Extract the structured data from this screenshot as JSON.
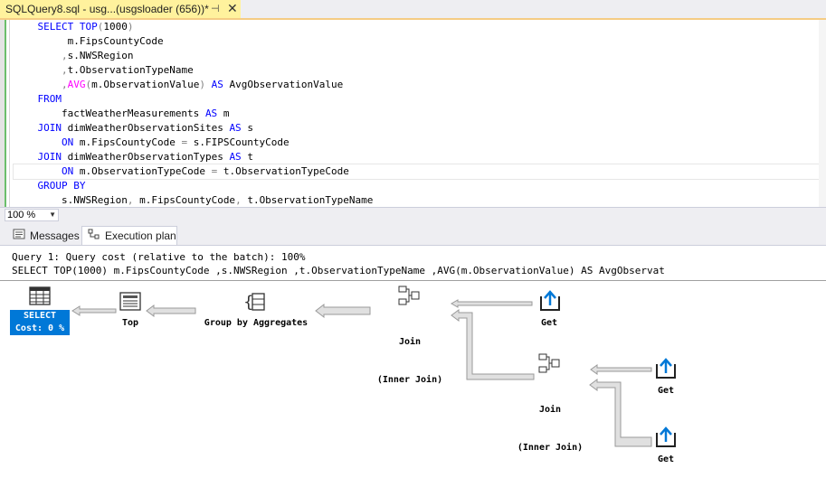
{
  "tab": {
    "title": "SQLQuery8.sql - usg...(usgsloader (656))*",
    "pin_glyph": "⊣",
    "close_glyph": "✕"
  },
  "editor": {
    "lines": [
      {
        "a": "    ",
        "b": "SELECT TOP",
        "c": "(1000)",
        "d": "",
        "e": "",
        "f": ""
      },
      {
        "a": "         m.FipsCountyCode",
        "b": "",
        "c": "",
        "d": "",
        "e": "",
        "f": ""
      },
      {
        "a": "        ",
        "b": "",
        "c": "",
        "d": ",",
        "e": "s.NWSRegion",
        "f": ""
      },
      {
        "a": "        ",
        "b": "",
        "c": "",
        "d": ",",
        "e": "t.ObservationTypeName",
        "f": ""
      },
      {
        "a": "        ",
        "b": "",
        "c": "",
        "d": ",",
        "e": "",
        "f": ""
      }
    ],
    "code": [
      "    SELECT TOP(1000)",
      "         m.FipsCountyCode",
      "        ,s.NWSRegion",
      "        ,t.ObservationTypeName",
      "        ,AVG(m.ObservationValue) AS AvgObservationValue",
      "    FROM",
      "        factWeatherMeasurements AS m",
      "    JOIN dimWeatherObservationSites AS s",
      "        ON m.FipsCountyCode = s.FIPSCountyCode",
      "    JOIN dimWeatherObservationTypes AS t",
      "        ON m.ObservationTypeCode = t.ObservationTypeCode",
      "    GROUP BY",
      "        s.NWSRegion, m.FipsCountyCode, t.ObservationTypeName"
    ]
  },
  "zoom": {
    "value": "100 %",
    "arrow": "▼"
  },
  "result_tabs": [
    {
      "label": "Messages",
      "icon": "messages-icon"
    },
    {
      "label": "Execution plan",
      "icon": "execution-plan-icon"
    }
  ],
  "plan": {
    "cost_line": "Query 1: Query cost (relative to the batch): 100%",
    "query_line": "SELECT TOP(1000) m.FipsCountyCode ,s.NWSRegion ,t.ObservationTypeName ,AVG(m.ObservationValue) AS AvgObservat",
    "operators": {
      "select_name": "SELECT",
      "select_cost": "Cost: 0 %",
      "top": "Top",
      "group_by": "Group by Aggregates",
      "join1": "Join",
      "join1_type": "(Inner Join)",
      "get1": "Get",
      "join2": "Join",
      "join2_type": "(Inner Join)",
      "get2": "Get",
      "get3": "Get"
    }
  },
  "colors": {
    "keyword": "#0000ff",
    "function": "#ff00ff",
    "operator": "#808080",
    "selection": "#0078d7",
    "tab_active": "#fff29d"
  }
}
